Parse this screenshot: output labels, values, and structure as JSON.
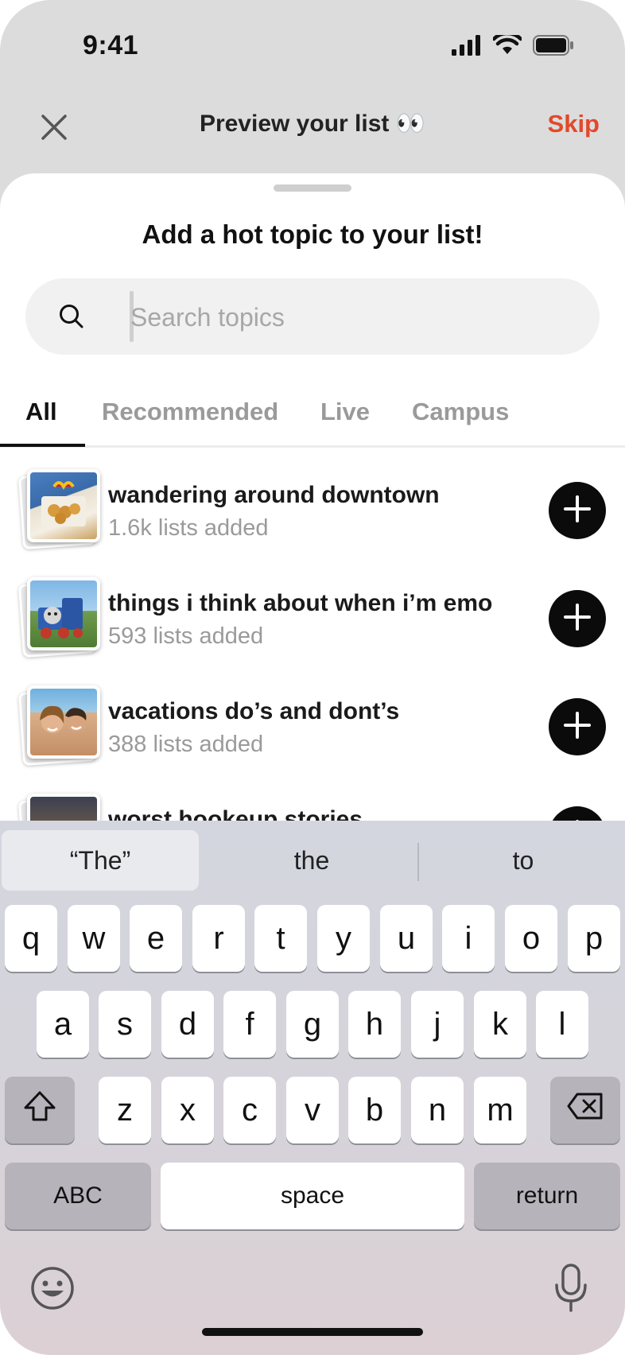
{
  "status": {
    "time": "9:41",
    "icons": [
      "signal-icon",
      "wifi-icon",
      "battery-icon"
    ]
  },
  "nav": {
    "title": "Preview your list 👀",
    "skip": "Skip",
    "accent": "#e2492a"
  },
  "sheet": {
    "title": "Add a hot topic to your list!",
    "search_placeholder": "Search topics"
  },
  "tabs": [
    {
      "label": "All",
      "active": true
    },
    {
      "label": "Recommended",
      "active": false
    },
    {
      "label": "Live",
      "active": false
    },
    {
      "label": "Campus",
      "active": false
    }
  ],
  "topics": [
    {
      "title": "wandering around downtown",
      "subtitle": "1.6k lists added"
    },
    {
      "title": "things i think about when i’m emo",
      "subtitle": "593 lists added"
    },
    {
      "title": "vacations do’s and dont’s",
      "subtitle": "388 lists added"
    },
    {
      "title": "worst hookeup stories",
      "subtitle": ""
    }
  ],
  "keyboard": {
    "suggestions": [
      "“The”",
      "the",
      "to"
    ],
    "row1": [
      "q",
      "w",
      "e",
      "r",
      "t",
      "y",
      "u",
      "i",
      "o",
      "p"
    ],
    "row2": [
      "a",
      "s",
      "d",
      "f",
      "g",
      "h",
      "j",
      "k",
      "l"
    ],
    "row3": [
      "z",
      "x",
      "c",
      "v",
      "b",
      "n",
      "m"
    ],
    "abc": "ABC",
    "space": "space",
    "return": "return"
  }
}
